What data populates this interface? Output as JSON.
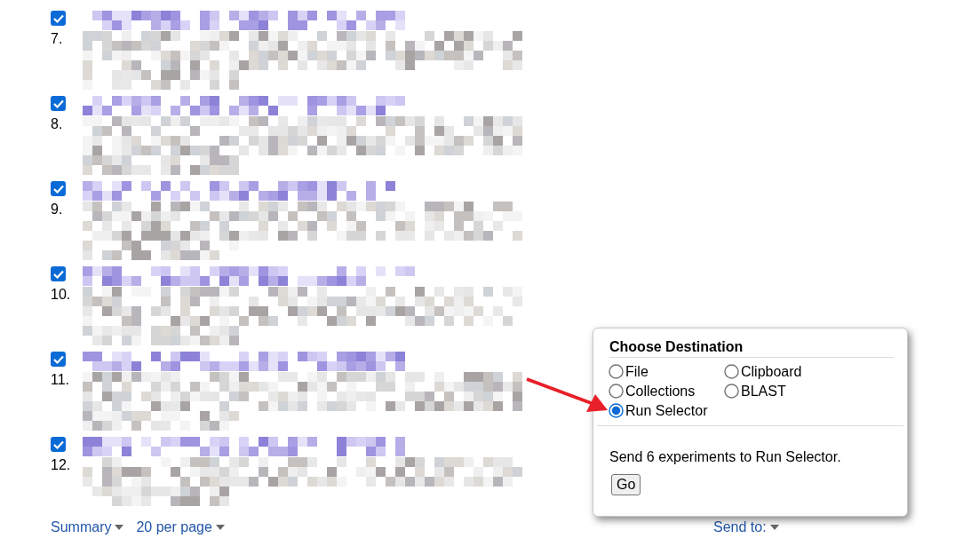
{
  "results": [
    {
      "number": "7.",
      "checked": true
    },
    {
      "number": "8.",
      "checked": true
    },
    {
      "number": "9.",
      "checked": true
    },
    {
      "number": "10.",
      "checked": true
    },
    {
      "number": "11.",
      "checked": true
    },
    {
      "number": "12.",
      "checked": true
    }
  ],
  "footer": {
    "format": "Summary",
    "per_page": "20 per page",
    "send_to": "Send to:"
  },
  "popup": {
    "title": "Choose Destination",
    "options": [
      {
        "label": "File",
        "selected": false
      },
      {
        "label": "Clipboard",
        "selected": false
      },
      {
        "label": "Collections",
        "selected": false
      },
      {
        "label": "BLAST",
        "selected": false
      },
      {
        "label": "Run Selector",
        "selected": true
      }
    ],
    "message": "Send 6 experiments to Run Selector.",
    "button": "Go"
  }
}
